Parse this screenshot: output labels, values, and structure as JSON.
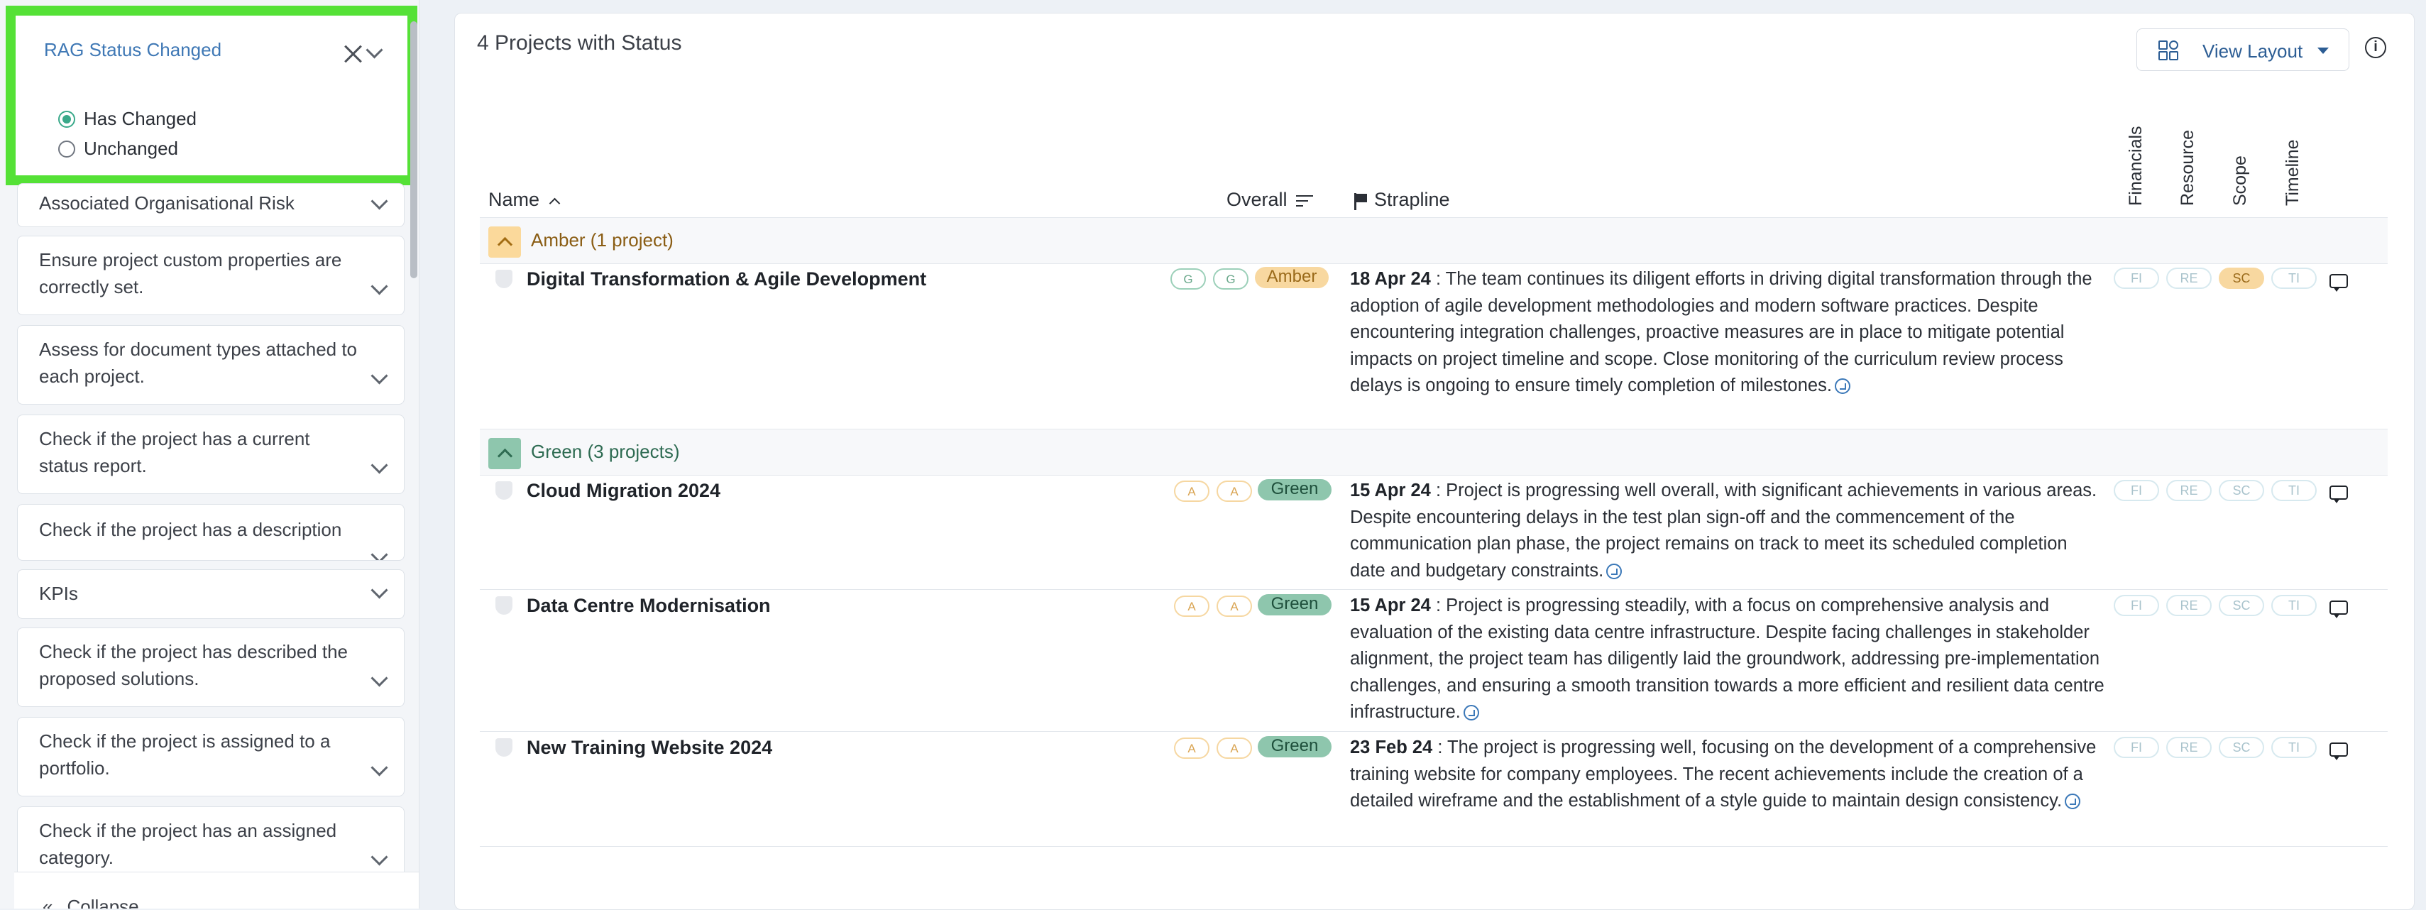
{
  "sidebar": {
    "rag_filter": {
      "title": "RAG Status Changed",
      "options": [
        {
          "label": "Has Changed",
          "selected": true
        },
        {
          "label": "Unchanged",
          "selected": false
        }
      ]
    },
    "filters": [
      {
        "line1": "Associated Organisational Risk",
        "line2": ""
      },
      {
        "line1": "Ensure project custom properties are",
        "line2": "correctly set."
      },
      {
        "line1": "Assess for document types attached to",
        "line2": "each project."
      },
      {
        "line1": "Check if the project has a current",
        "line2": "status report."
      },
      {
        "line1": "Check if the project has a description",
        "line2": ""
      },
      {
        "line1": "KPIs",
        "line2": ""
      },
      {
        "line1": "Check if the project has described the",
        "line2": "proposed solutions."
      },
      {
        "line1": "Check if the project is assigned to a",
        "line2": "portfolio."
      },
      {
        "line1": "Check if the project has an assigned",
        "line2": "category."
      }
    ],
    "collapse_label": "Collapse"
  },
  "main": {
    "title": "4 Projects with Status",
    "view_layout_label": "View Layout",
    "columns": {
      "name": "Name",
      "overall": "Overall",
      "strapline": "Strapline",
      "financials": "Financials",
      "resource": "Resource",
      "scope": "Scope",
      "timeline": "Timeline"
    },
    "groups": [
      {
        "label": "Amber (1 project)",
        "status": "amber",
        "projects": [
          {
            "name": "Digital Transformation & Agile Development",
            "small_pills": [
              "G",
              "G"
            ],
            "overall": "Amber",
            "date": "18 Apr 24",
            "strapline": "The team continues its diligent efforts in driving digital transformation through the adoption of agile development methodologies and modern software practices. Despite encountering integration challenges, proactive measures are in place to mitigate potential impacts on project timeline and scope. Close monitoring of the curriculum review process delays is ongoing to ensure timely completion of milestones.",
            "dims": [
              "FI",
              "RE",
              "SC",
              "TI"
            ],
            "dim_states": [
              "off",
              "off",
              "amber",
              "off"
            ]
          }
        ]
      },
      {
        "label": "Green (3 projects)",
        "status": "green",
        "projects": [
          {
            "name": "Cloud Migration 2024",
            "small_pills": [
              "A",
              "A"
            ],
            "overall": "Green",
            "date": "15 Apr 24",
            "strapline": "Project is progressing well overall, with significant achievements in various areas. Despite encountering delays in the test plan sign-off and the commencement of the communication plan phase, the project remains on track to meet its scheduled completion date and budgetary constraints.",
            "dims": [
              "FI",
              "RE",
              "SC",
              "TI"
            ],
            "dim_states": [
              "off",
              "off",
              "off",
              "off"
            ]
          },
          {
            "name": "Data Centre Modernisation",
            "small_pills": [
              "A",
              "A"
            ],
            "overall": "Green",
            "date": "15 Apr 24",
            "strapline": "Project is progressing steadily, with a focus on comprehensive analysis and evaluation of the existing data centre infrastructure. Despite facing challenges in stakeholder alignment, the project team has diligently laid the groundwork, addressing pre-implementation challenges, and ensuring a smooth transition towards a more efficient and resilient data centre infrastructure.",
            "dims": [
              "FI",
              "RE",
              "SC",
              "TI"
            ],
            "dim_states": [
              "off",
              "off",
              "off",
              "off"
            ]
          },
          {
            "name": "New Training Website 2024",
            "small_pills": [
              "A",
              "A"
            ],
            "overall": "Green",
            "date": "23 Feb 24",
            "strapline": "The project is progressing well, focusing on the development of a comprehensive training website for company employees. The recent achievements include the creation of a detailed wireframe and the establishment of a style guide to maintain design consistency.",
            "dims": [
              "FI",
              "RE",
              "SC",
              "TI"
            ],
            "dim_states": [
              "off",
              "off",
              "off",
              "off"
            ]
          }
        ]
      }
    ]
  }
}
